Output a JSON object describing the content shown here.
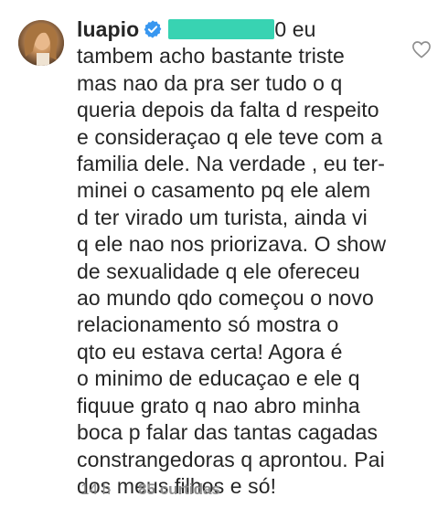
{
  "comment": {
    "username": "luapio",
    "mention_tail": "0 eu",
    "lines": [
      "tambem acho bastante triste",
      "mas nao da pra ser tudo o q",
      "queria depois da falta d respeito",
      "e consideraçao q ele teve com a",
      "familia dele. Na verdade , eu ter-",
      "minei o casamento pq ele alem",
      "d ter virado um turista, ainda vi",
      "q ele nao nos priorizava. O show",
      "de sexualidade q ele ofereceu",
      "ao mundo qdo começou o novo",
      "relacionamento só mostra o",
      "qto eu estava certa! Agora é",
      "o minimo de educaçao e ele q",
      "fiquue grato q nao abro minha",
      "boca p falar das tantas cagadas",
      "constrangedoras q aprontou. Pai",
      "dos meus filhos e só!"
    ],
    "time": "14 h",
    "likes": "85 curtidas"
  },
  "colors": {
    "verified_badge": "#3897f0",
    "redaction": "#38d3b2",
    "meta_text": "#8e8e8e"
  },
  "icons": {
    "verified": "verified-badge-icon",
    "like": "heart-outline-icon"
  }
}
